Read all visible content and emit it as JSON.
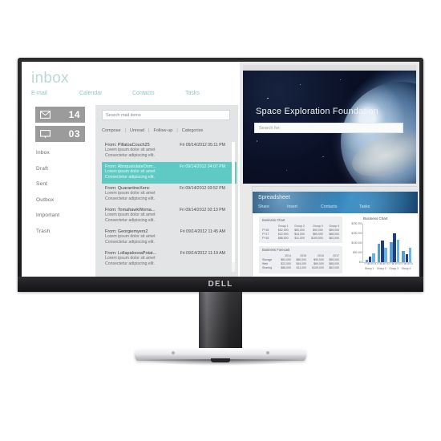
{
  "product": {
    "brand": "DELL",
    "brand_letters": [
      "D",
      "E",
      "L",
      "L"
    ]
  },
  "mail_app": {
    "title": "inbox",
    "nav": [
      {
        "label": "E-mail"
      },
      {
        "label": "Calendar"
      },
      {
        "label": "Contacts"
      },
      {
        "label": "Tasks"
      }
    ],
    "counters": [
      {
        "icon": "envelope-icon",
        "value": "14"
      },
      {
        "icon": "chat-bubble-icon",
        "value": "03"
      }
    ],
    "folders": [
      "Inbox",
      "Draft",
      "Sent",
      "Outbox",
      "Important",
      "Trash"
    ],
    "search": {
      "placeholder": "Search mail items",
      "value": ""
    },
    "actions": [
      "Compose",
      "Unread",
      "Follow-up",
      "Categorize"
    ],
    "action_separator": "|",
    "messages": [
      {
        "from": "From: PillaloaCouch25",
        "date": "Fri 09/14/2012 05:11 PM",
        "line1": "Lorem ipsum dolor sit amet",
        "line2": "Consectetur adipiscing elit.",
        "selected": false
      },
      {
        "from": "From: AbsquatulateOsm...",
        "date": "Fri 09/14/2012 04:07 PM",
        "line1": "Lorem ipsum dolor sit amet",
        "line2": "Consectetur adipiscing elit.",
        "selected": true
      },
      {
        "from": "From: QuarantineXenc",
        "date": "Fri 09/14/2012 03:52 PM",
        "line1": "Lorem ipsum dolor sit amet",
        "line2": "Consectetur adipiscing elit.",
        "selected": false
      },
      {
        "from": "From: TomahawkWoma...",
        "date": "Fri 09/14/2012 02:13 PM",
        "line1": "Lorem ipsum dolor sit amet",
        "line2": "Consectetur adipiscing elit.",
        "selected": false
      },
      {
        "from": "From: Georgiemyers2",
        "date": "Fri 09/14/2012 11:45 AM",
        "line1": "Lorem ipsum dolor sit amet",
        "line2": "Consectetur adipiscing elit.",
        "selected": false
      },
      {
        "from": "From: LollapalooxaPotat...",
        "date": "Fri 09/14/2012 11:19 AM",
        "line1": "Lorem ipsum dolor sit amet",
        "line2": "Consectetur adipiscing elit.",
        "selected": false
      }
    ]
  },
  "space_site": {
    "title": "Space Exploration Foundation",
    "search": {
      "placeholder": "Search for:",
      "value": ""
    }
  },
  "spreadsheet": {
    "title": "Spreadsheet",
    "nav": [
      "Share",
      "Insert",
      "Contacts",
      "Tasks"
    ],
    "business_chart_card": {
      "title": "Business Chart",
      "columns": [
        "",
        "Group 1",
        "Group 2",
        "Group 3",
        "Group 4"
      ],
      "rows": [
        [
          "FY18",
          "$52,000",
          "$80,000",
          "$90,000",
          "$55,000"
        ],
        [
          "FY17",
          "$22,000",
          "$44,000",
          "$69,000",
          "$68,000"
        ],
        [
          "FY16",
          "$88,000",
          "$11,000",
          "$109,000",
          "$62,000"
        ]
      ]
    },
    "business_forecast_card": {
      "title": "Business Forecast",
      "columns": [
        "",
        "2014",
        "2015",
        "2016",
        "2017"
      ],
      "rows": [
        [
          "Storage",
          "$52,000",
          "$80,000",
          "$90,000",
          "$55,000"
        ],
        [
          "Web",
          "$22,000",
          "$44,000",
          "$69,000",
          "$68,000"
        ],
        [
          "Sharing",
          "$88,000",
          "$11,000",
          "$109,000",
          "$62,000"
        ]
      ]
    },
    "chart_data": {
      "type": "bar",
      "title": "Business Chart",
      "xlabel": "",
      "ylabel": "",
      "grid": false,
      "legend": false,
      "ylim": [
        0,
        250000
      ],
      "yticks": [
        "$0",
        "$50,000",
        "$100,000",
        "$150,000",
        "$200,000"
      ],
      "categories": [
        "Group 1",
        "Group 2",
        "Group 3",
        "Group 4"
      ],
      "sub_ticks": [
        "FY16",
        "FY17",
        "FY18"
      ],
      "series": [
        {
          "name": "FY16",
          "color": "#5b9bd5",
          "values": [
            18000,
            118000,
            128000,
            72000
          ]
        },
        {
          "name": "FY17",
          "color": "#1f3f7a",
          "values": [
            34000,
            140000,
            188000,
            52000
          ]
        },
        {
          "name": "FY18",
          "color": "#6cb4e4",
          "values": [
            56000,
            96000,
            146000,
            92000
          ]
        }
      ]
    }
  }
}
